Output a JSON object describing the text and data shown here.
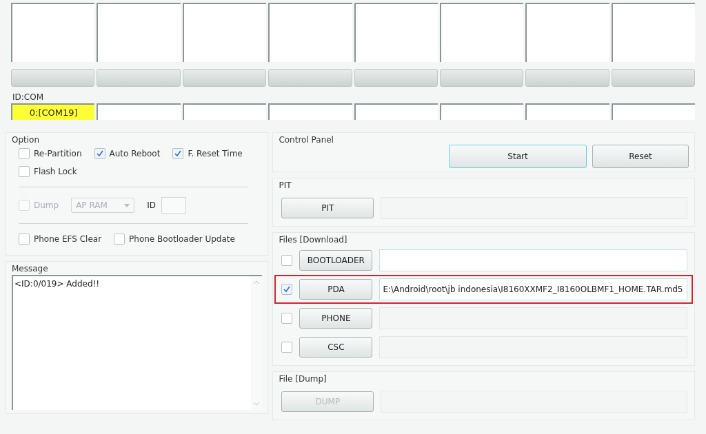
{
  "ports": [
    {
      "connected": true,
      "com": "0:[COM19]",
      "level": 0
    },
    {
      "connected": false,
      "level": 0
    },
    {
      "connected": false,
      "level": 0
    },
    {
      "connected": false,
      "level": 0
    },
    {
      "connected": false,
      "level": 0
    },
    {
      "connected": false,
      "level": 0
    },
    {
      "connected": false,
      "level": 0
    },
    {
      "connected": false,
      "level": 0
    }
  ],
  "id_com_label": "ID:COM",
  "option": {
    "title": "Option",
    "rows": [
      [
        {
          "label": "Re-Partition",
          "checked": false
        },
        {
          "label": "Auto Reboot",
          "checked": true
        },
        {
          "label": "F. Reset Time",
          "checked": true
        }
      ],
      [
        {
          "label": "Flash Lock",
          "checked": false
        }
      ]
    ],
    "dump": {
      "label": "Dump",
      "checked": false,
      "disabled": true,
      "select": "AP RAM",
      "id_label": "ID"
    },
    "bottom_row": [
      {
        "label": "Phone EFS Clear",
        "checked": false
      },
      {
        "label": "Phone Bootloader Update",
        "checked": false
      }
    ]
  },
  "message": {
    "title": "Message",
    "lines": [
      "<ID:0/019> Added!!"
    ]
  },
  "control_panel": {
    "title": "Control Panel",
    "buttons": [
      {
        "label": "Start",
        "focused": true
      },
      {
        "label": "Reset",
        "focused": false
      }
    ]
  },
  "pit": {
    "title": "PIT",
    "button": "PIT"
  },
  "files": {
    "title": "Files [Download]",
    "rows": [
      {
        "button": "BOOTLOADER",
        "checked": false,
        "highlighted": false
      },
      {
        "button": "PDA",
        "checked": true,
        "highlighted": true,
        "path": "E:\\Android\\root\\jb indonesia\\I8160XXMF2_I8160OLBMF1_HOME.TAR.md5"
      },
      {
        "button": "PHONE",
        "checked": false,
        "highlighted": false
      },
      {
        "button": "CSC",
        "checked": false,
        "highlighted": false
      }
    ]
  },
  "file_dump": {
    "title": "File [Dump]",
    "button": "DUMP",
    "disabled": true
  }
}
